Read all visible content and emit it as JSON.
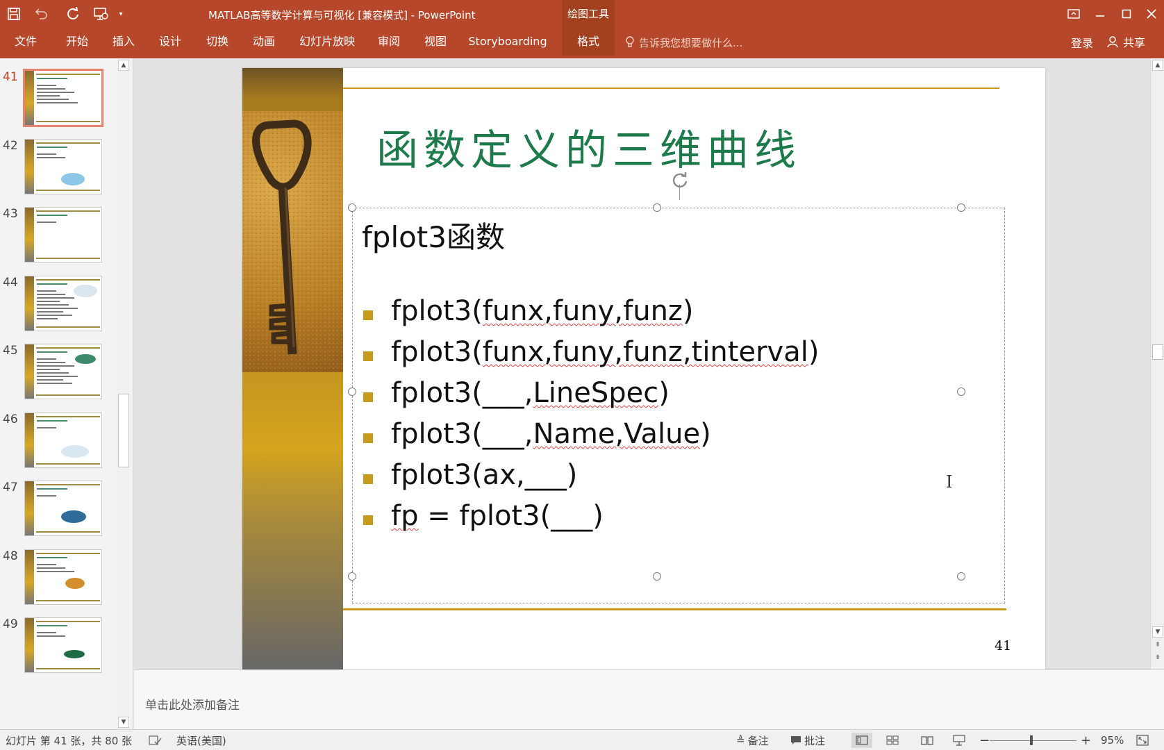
{
  "app": {
    "window_title": "MATLAB高等数学计算与可视化 [兼容模式] - PowerPoint",
    "contextual_tab_header": "绘图工具",
    "colors": {
      "accent": "#b7472a",
      "accent_dark": "#a3401f",
      "title_green": "#1d7a4b",
      "gold": "#c89a1b"
    }
  },
  "quick_access": {
    "save_icon": "save-icon",
    "undo_icon": "undo-icon",
    "redo_icon": "redo-icon",
    "present_icon": "start-from-beginning-icon",
    "customize_icon": "customize-qat-icon"
  },
  "ribbon": {
    "tabs": [
      {
        "label": "文件"
      },
      {
        "label": "开始"
      },
      {
        "label": "插入"
      },
      {
        "label": "设计"
      },
      {
        "label": "切换"
      },
      {
        "label": "动画"
      },
      {
        "label": "幻灯片放映"
      },
      {
        "label": "审阅"
      },
      {
        "label": "视图"
      },
      {
        "label": "Storyboarding"
      },
      {
        "label": "格式"
      }
    ],
    "tell_me_placeholder": "告诉我您想要做什么...",
    "login_label": "登录",
    "share_label": "共享"
  },
  "thumbnails": [
    {
      "number": "41",
      "active": true
    },
    {
      "number": "42"
    },
    {
      "number": "43"
    },
    {
      "number": "44"
    },
    {
      "number": "45"
    },
    {
      "number": "46"
    },
    {
      "number": "47"
    },
    {
      "number": "48"
    },
    {
      "number": "49"
    }
  ],
  "slide": {
    "title": "函数定义的三维曲线",
    "textbox_heading": "fplot3函数",
    "syntax_items": [
      [
        {
          "t": "fplot3("
        },
        {
          "t": "funx,funy,funz",
          "wavy": true
        },
        {
          "t": ")"
        }
      ],
      [
        {
          "t": "fplot3("
        },
        {
          "t": "funx,funy,funz,tinterval",
          "wavy": true
        },
        {
          "t": ")"
        }
      ],
      [
        {
          "t": "fplot3(___,"
        },
        {
          "t": "LineSpec",
          "wavy": true
        },
        {
          "t": ")"
        }
      ],
      [
        {
          "t": "fplot3(___,"
        },
        {
          "t": "Name,Value",
          "wavy": true
        },
        {
          "t": ")"
        }
      ],
      [
        {
          "t": "fplot3(ax,___)"
        }
      ],
      [
        {
          "t": "fp",
          "wavy": true
        },
        {
          "t": " = fplot3(___)"
        }
      ]
    ],
    "page_number": "41"
  },
  "notes": {
    "placeholder": "单击此处添加备注"
  },
  "status": {
    "slide_info": "幻灯片 第 41 张，共 80 张",
    "language": "英语(美国)",
    "notes_label": "备注",
    "comments_label": "批注",
    "zoom": "95%"
  }
}
